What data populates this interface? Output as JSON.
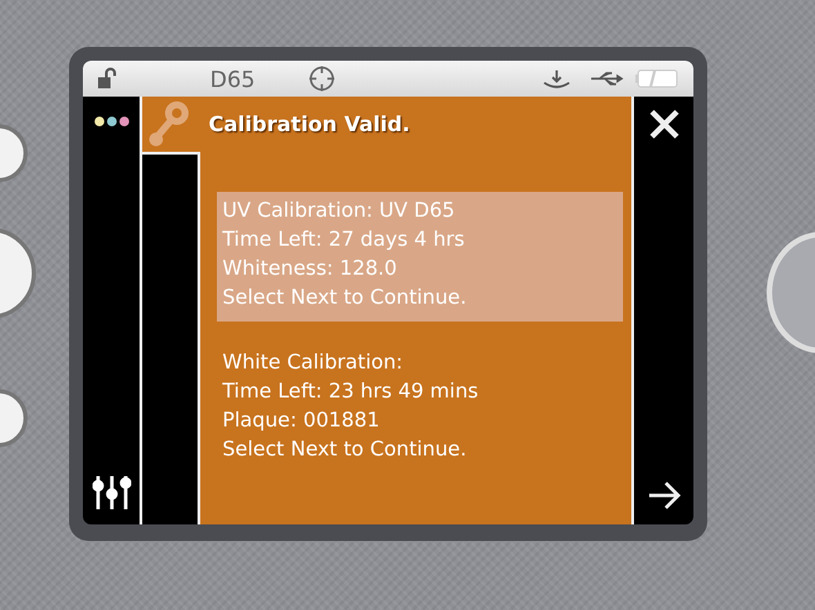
{
  "status_bar": {
    "illuminant": "D65"
  },
  "title": "Calibration Valid.",
  "sections": [
    {
      "selected": true,
      "lines": [
        "UV Calibration: UV D65",
        "Time Left: 27 days 4 hrs",
        "Whiteness: 128.0",
        "Select Next to Continue."
      ]
    },
    {
      "selected": false,
      "lines": [
        "White Calibration:",
        "Time Left: 23 hrs 49 mins",
        "Plaque: 001881",
        "Select Next to Continue."
      ]
    }
  ]
}
